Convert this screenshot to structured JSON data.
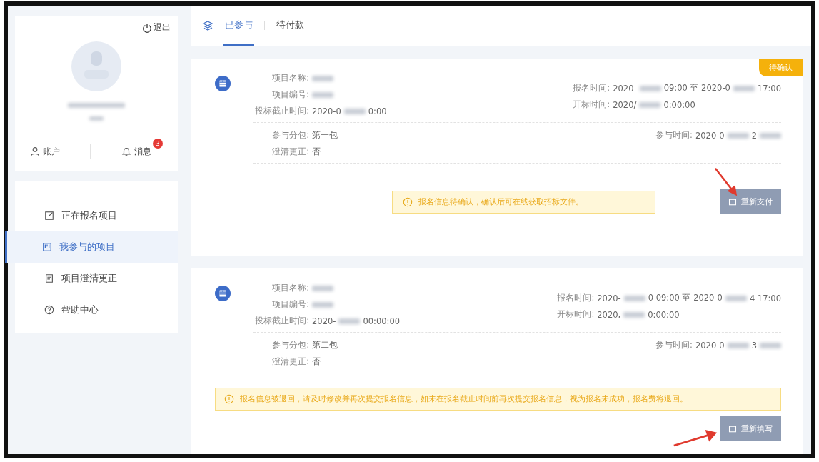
{
  "sidebar": {
    "logout": "退出",
    "account": {
      "label": "账户"
    },
    "messages": {
      "label": "消息",
      "badge": "3"
    },
    "items": [
      {
        "label": "正在报名项目",
        "selected": false
      },
      {
        "label": "我参与的项目",
        "selected": true
      },
      {
        "label": "项目澄清更正",
        "selected": false
      },
      {
        "label": "帮助中心",
        "selected": false
      }
    ]
  },
  "tabs": [
    {
      "label": "已参与",
      "selected": true
    },
    {
      "label": "待付款",
      "selected": false
    }
  ],
  "cards": [
    {
      "kind": "pending",
      "status": "待确认",
      "left": [
        {
          "label": "项目名称:",
          "segments": [
            {
              "kind": "blur"
            }
          ]
        },
        {
          "label": "项目编号:",
          "segments": [
            {
              "kind": "blur"
            }
          ]
        },
        {
          "label": "投标截止时间:",
          "segments": [
            {
              "kind": "text",
              "text": "2020-0"
            },
            {
              "kind": "blur"
            },
            {
              "kind": "text",
              "text": "0:00"
            }
          ]
        }
      ],
      "right": [
        {
          "label": "报名时间:",
          "segments": [
            {
              "kind": "text",
              "text": "2020-"
            },
            {
              "kind": "blur"
            },
            {
              "kind": "text",
              "text": "09:00 至 2020-0"
            },
            {
              "kind": "blur"
            },
            {
              "kind": "text",
              "text": "17:00"
            }
          ]
        },
        {
          "label": "开标时间:",
          "segments": [
            {
              "kind": "text",
              "text": "2020/"
            },
            {
              "kind": "blur"
            },
            {
              "kind": "text",
              "text": "0:00:00"
            }
          ]
        }
      ],
      "lower_left": [
        {
          "label": "参与分包:",
          "segments": [
            {
              "kind": "text",
              "text": "第一包"
            }
          ]
        },
        {
          "label": "澄清更正:",
          "segments": [
            {
              "kind": "text",
              "text": "否"
            }
          ]
        }
      ],
      "lower_right": [
        {
          "label": "参与时间:",
          "segments": [
            {
              "kind": "text",
              "text": "2020-0"
            },
            {
              "kind": "blur"
            },
            {
              "kind": "text",
              "text": "2"
            },
            {
              "kind": "blur"
            }
          ]
        }
      ],
      "alert": "报名信息待确认，确认后可在线获取招标文件。",
      "button": {
        "label": "重新支付",
        "disabled": true
      }
    },
    {
      "kind": "returned",
      "left": [
        {
          "label": "项目名称:",
          "segments": [
            {
              "kind": "blur"
            }
          ]
        },
        {
          "label": "项目编号:",
          "segments": [
            {
              "kind": "blur"
            }
          ]
        },
        {
          "label": "投标截止时间:",
          "segments": [
            {
              "kind": "text",
              "text": "2020-"
            },
            {
              "kind": "blur"
            },
            {
              "kind": "text",
              "text": "00:00:00"
            }
          ]
        }
      ],
      "right": [
        {
          "label": "报名时间:",
          "segments": [
            {
              "kind": "text",
              "text": "2020-"
            },
            {
              "kind": "blur"
            },
            {
              "kind": "text",
              "text": "0 09:00 至 2020-0"
            },
            {
              "kind": "blur"
            },
            {
              "kind": "text",
              "text": "4 17:00"
            }
          ]
        },
        {
          "label": "开标时间:",
          "segments": [
            {
              "kind": "text",
              "text": "2020,"
            },
            {
              "kind": "blur"
            },
            {
              "kind": "text",
              "text": "0:00:00"
            }
          ]
        }
      ],
      "lower_left": [
        {
          "label": "参与分包:",
          "segments": [
            {
              "kind": "text",
              "text": "第二包"
            }
          ]
        },
        {
          "label": "澄清更正:",
          "segments": [
            {
              "kind": "text",
              "text": "否"
            }
          ]
        }
      ],
      "lower_right": [
        {
          "label": "参与时间:",
          "segments": [
            {
              "kind": "text",
              "text": "2020-0"
            },
            {
              "kind": "blur"
            },
            {
              "kind": "text",
              "text": "3"
            },
            {
              "kind": "blur"
            }
          ]
        }
      ],
      "alert": "报名信息被退回，请及时修改并再次提交报名信息，如未在报名截止时间前再次提交报名信息，视为报名未成功，报名费将退回。",
      "button": {
        "label": "重新填写",
        "disabled": true
      }
    }
  ]
}
